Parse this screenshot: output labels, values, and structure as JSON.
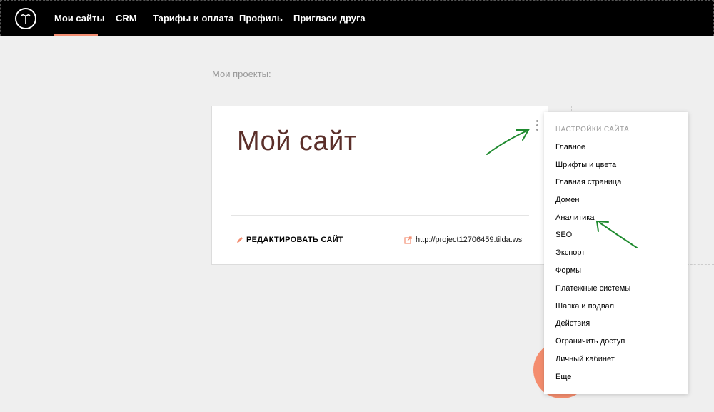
{
  "nav": {
    "items": [
      {
        "label": "Мои сайты",
        "active": true
      },
      {
        "label": "CRM",
        "active": false
      },
      {
        "label": "Тарифы и оплата",
        "active": false
      },
      {
        "label": "Профиль",
        "active": false
      },
      {
        "label": "Пригласи друга",
        "active": false
      }
    ]
  },
  "section": {
    "title": "Мои проекты:"
  },
  "project": {
    "name": "Мой сайт",
    "edit_label": "РЕДАКТИРОВАТЬ САЙТ",
    "url": "http://project12706459.tilda.ws"
  },
  "menu": {
    "header": "НАСТРОЙКИ САЙТА",
    "items": [
      "Главное",
      "Шрифты и цвета",
      "Главная страница",
      "Домен",
      "Аналитика",
      "SEO",
      "Экспорт",
      "Формы",
      "Платежные системы",
      "Шапка и подвал",
      "Действия",
      "Ограничить доступ",
      "Личный кабинет",
      "Еще"
    ]
  },
  "colors": {
    "accent": "#f38e72",
    "arrow": "#1e8a2e",
    "title": "#5b2f2a"
  },
  "icons": {
    "logo": "tilda-logo-icon",
    "edit": "pencil-icon",
    "external_link": "external-link-icon",
    "more": "vertical-dots-icon"
  }
}
